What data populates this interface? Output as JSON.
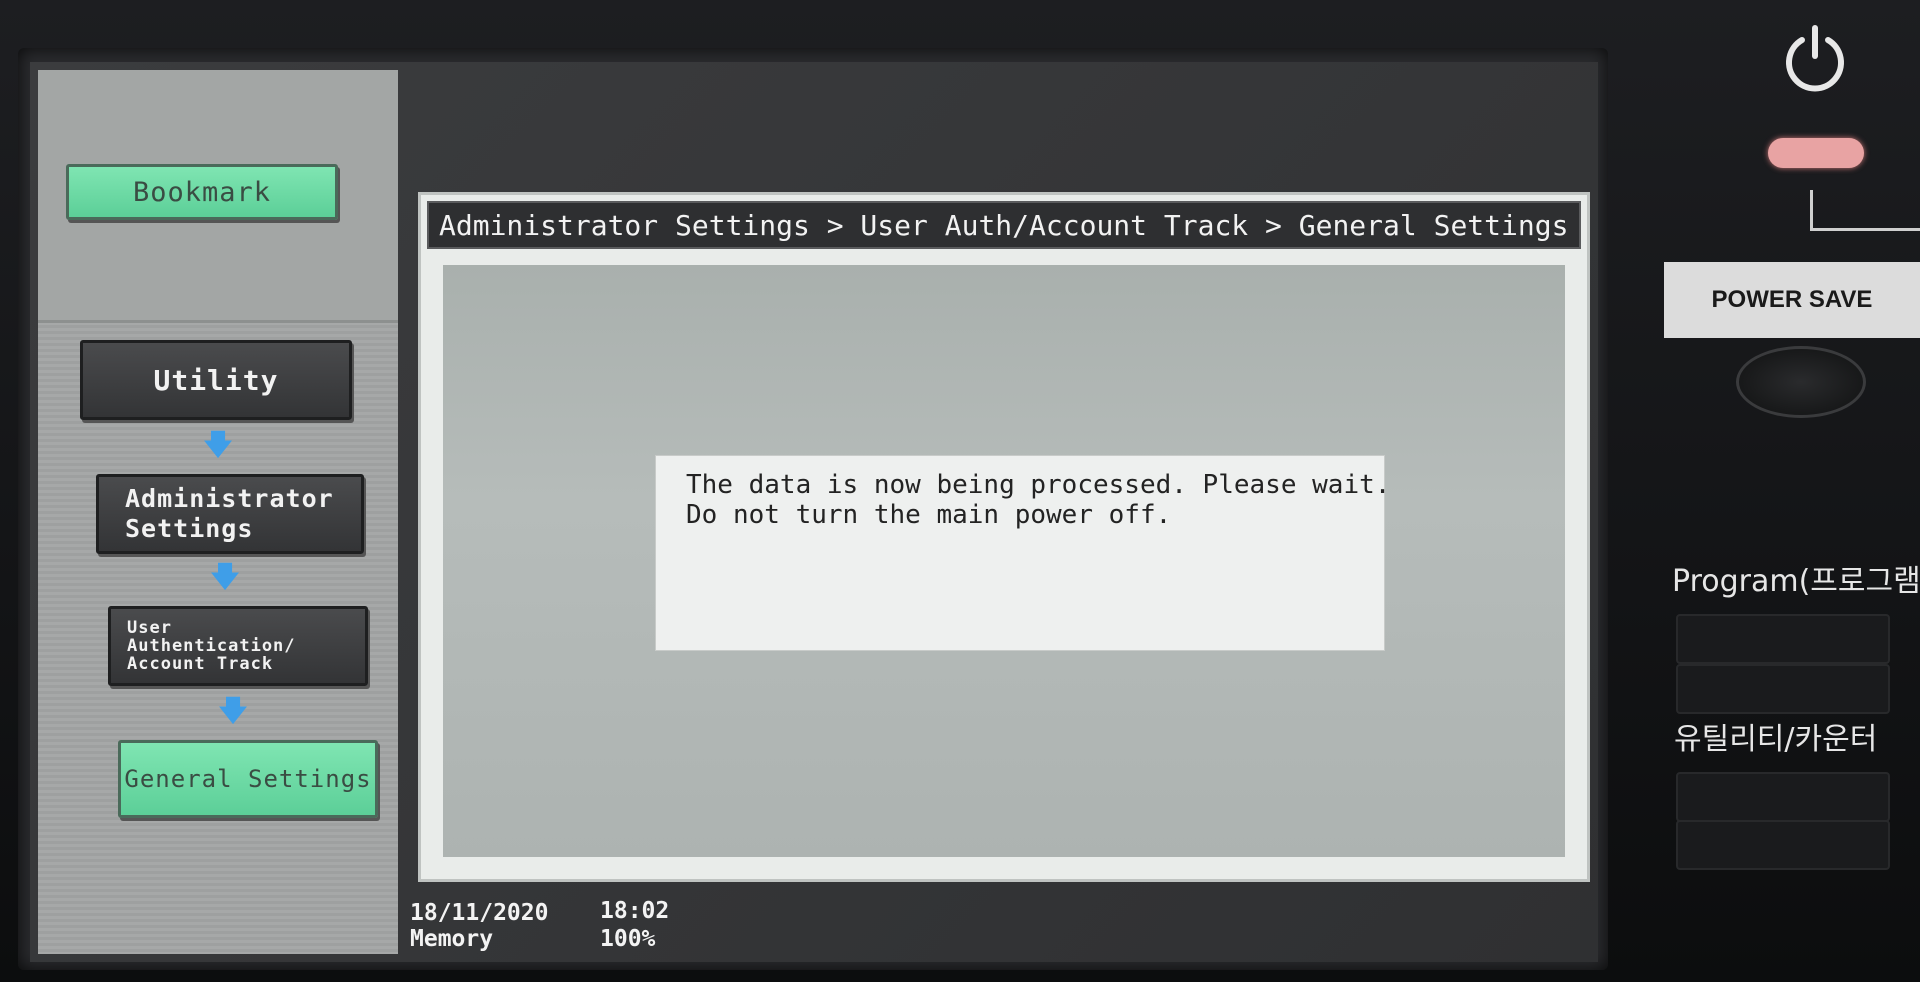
{
  "left_nav": {
    "bookmark": "Bookmark",
    "utility": "Utility",
    "administrator_settings": "Administrator Settings",
    "user_authentication": "User Authentication/ Account Track",
    "general_settings": "General Settings"
  },
  "breadcrumb": {
    "text": "Administrator Settings > User Auth/Account Track  > General Settings"
  },
  "message": {
    "line1": "The data is now being processed. Please wait.",
    "line2": "Do not turn the main power off."
  },
  "status_bar": {
    "date": "18/11/2020",
    "time": "18:02",
    "memory_label": "Memory",
    "memory_value": "100%"
  },
  "hardware": {
    "power_save": "POWER SAVE",
    "program": "Program(프로그램)",
    "utility_counter": "유틸리티/카운터"
  },
  "colors": {
    "accent_green": "#6ad8a4",
    "arrow_blue": "#3f9ee8",
    "dark_button": "#3a3b3d"
  }
}
